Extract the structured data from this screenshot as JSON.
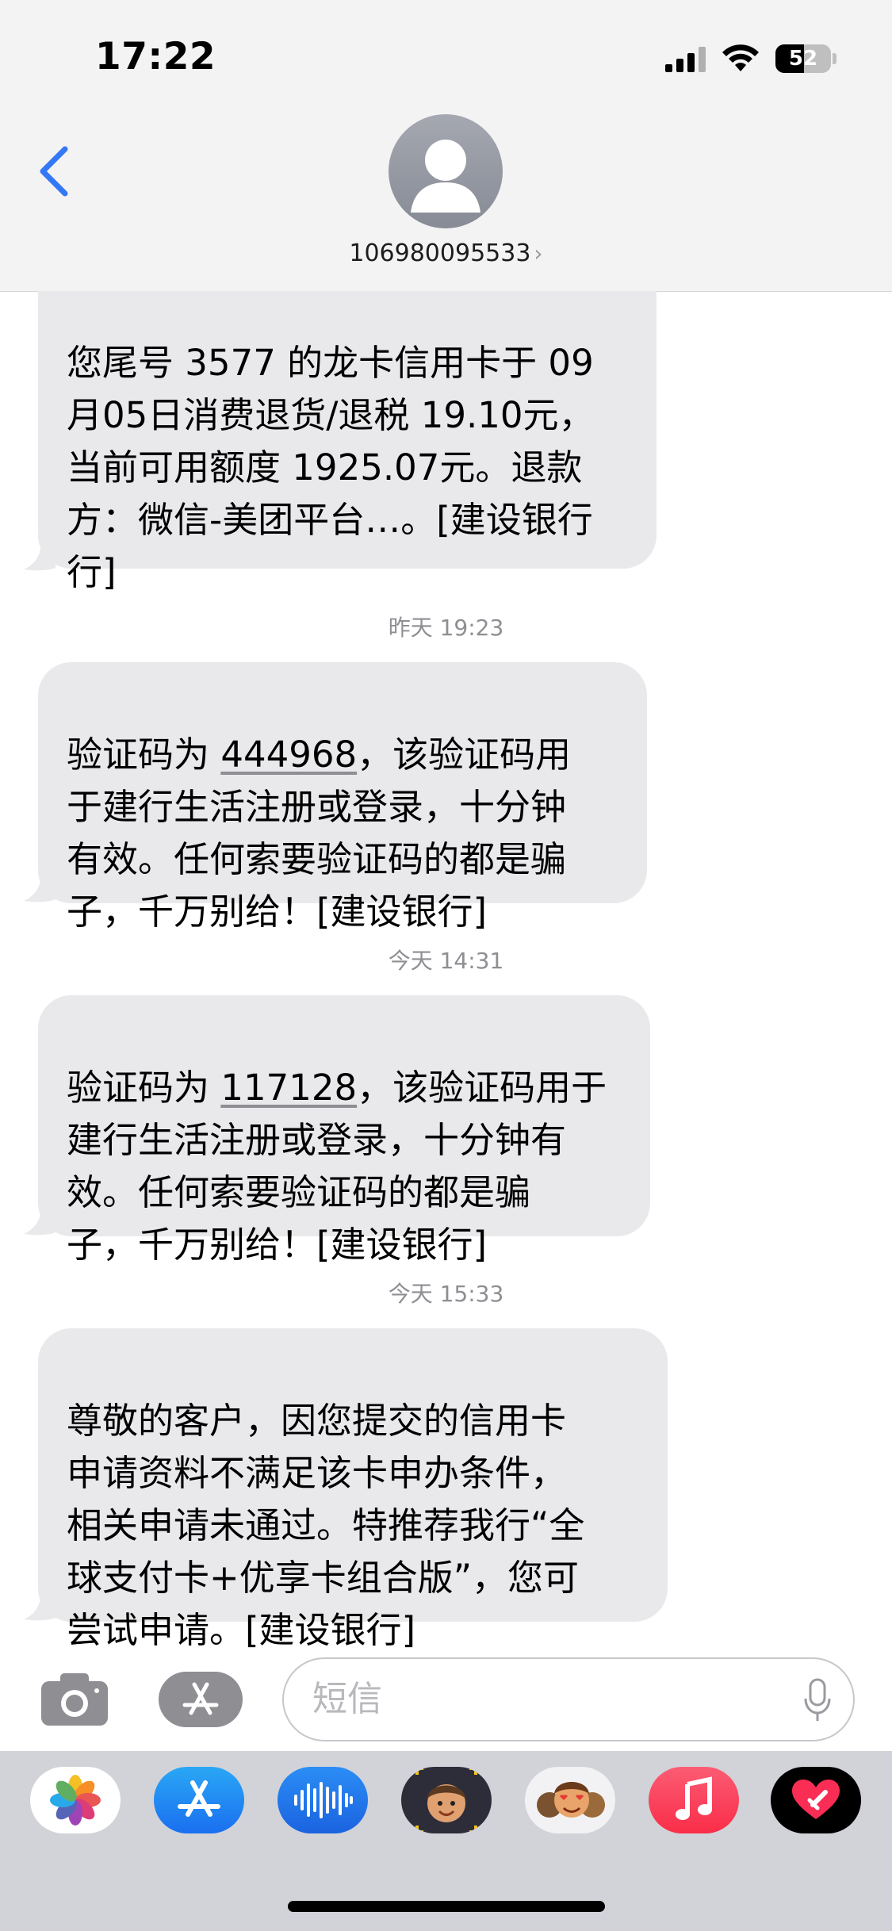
{
  "status_bar": {
    "time": "17:22",
    "battery": "52",
    "battery_level": 0.52
  },
  "header": {
    "contact_number": "106980095533",
    "chevron": "›"
  },
  "messages": [
    {
      "text": "您尾号 3577 的龙卡信用卡于 09\n月05日消费退货/退税 19.10元，\n当前可用额度 1925.07元。退款\n方：微信-美团平台…。[建设银行\n行]"
    },
    {
      "timestamp_day": "昨天",
      "timestamp_time": "19:23",
      "text_before": "验证码为 ",
      "code": "444968",
      "text_after": "，该验证码用\n于建行生活注册或登录，十分钟\n有效。任何索要验证码的都是骗\n子，千万别给！[建设银行]"
    },
    {
      "timestamp_day": "今天",
      "timestamp_time": "14:31",
      "text_before": "验证码为 ",
      "code": "117128",
      "text_after": "，该验证码用于\n建行生活注册或登录，十分钟有\n效。任何索要验证码的都是骗\n子，千万别给！[建设银行]"
    },
    {
      "timestamp_day": "今天",
      "timestamp_time": "15:33",
      "text": "尊敬的客户，因您提交的信用卡\n申请资料不满足该卡申办条件，\n相关申请未通过。特推荐我行“全\n球支付卡+优享卡组合版”，您可\n尝试申请。[建设银行]"
    }
  ],
  "input": {
    "placeholder": "短信"
  },
  "app_drawer": {
    "apps": [
      "photos-app",
      "app-store-app",
      "audio-message-app",
      "memoji-app",
      "animoji-stickers-app",
      "music-app",
      "digital-touch-app"
    ]
  },
  "colors": {
    "bubble": "#e9e9eb",
    "header_bg": "#f3f3f3",
    "ios_blue": "#3478f6",
    "timestamp": "#8e8e93"
  }
}
